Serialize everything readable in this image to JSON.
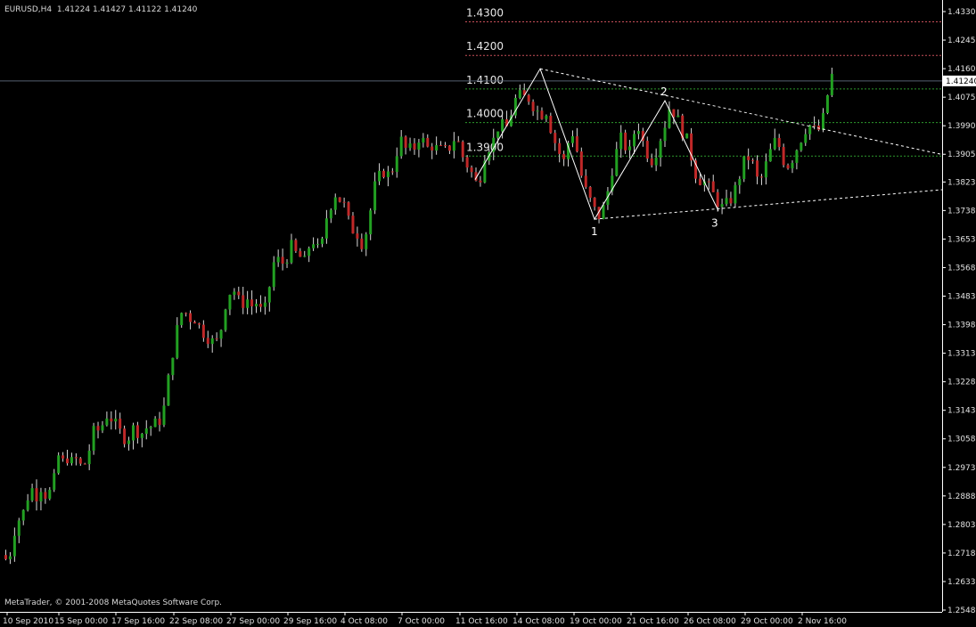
{
  "header": {
    "symbol_label": "EURUSD,H4",
    "ohlc_label": "1.41224 1.41427 1.41122 1.41240"
  },
  "footer": {
    "copyright": "MetaTrader, © 2001-2008 MetaQuotes Software Corp."
  },
  "colors": {
    "background": "#000000",
    "axis": "#ffffff",
    "bull_candle": "#22a022",
    "bear_candle": "#c02828",
    "wick": "#d8d8d8",
    "level_red": "#c8505a",
    "level_green": "#2e9a2e",
    "drawing": "#ffffff",
    "current_price_box": "#ffffff",
    "current_price_text": "#000000",
    "price_line": "#556070"
  },
  "chart_data": {
    "type": "candlestick",
    "symbol": "EURUSD",
    "timeframe": "H4",
    "ylim": [
      1.2548,
      1.4345
    ],
    "y_ticks": [
      "1.43305",
      "1.42455",
      "1.41605",
      "1.40755",
      "1.39905",
      "1.39055",
      "1.38230",
      "1.37380",
      "1.36530",
      "1.35680",
      "1.34830",
      "1.33980",
      "1.33130",
      "1.32280",
      "1.31430",
      "1.30580",
      "1.29730",
      "1.28880",
      "1.28030",
      "1.27180",
      "1.26330",
      "1.25480"
    ],
    "x_ticks": [
      "10 Sep 2010",
      "15 Sep 00:00",
      "17 Sep 16:00",
      "22 Sep 08:00",
      "27 Sep 00:00",
      "29 Sep 16:00",
      "4 Oct 08:00",
      "7 Oct 00:00",
      "11 Oct 16:00",
      "14 Oct 08:00",
      "19 Oct 00:00",
      "21 Oct 16:00",
      "26 Oct 08:00",
      "29 Oct 00:00",
      "2 Nov 16:00"
    ],
    "current_price": "1.41240",
    "close_path": [
      [
        0,
        1.27
      ],
      [
        5,
        1.272
      ],
      [
        10,
        1.279
      ],
      [
        15,
        1.282
      ],
      [
        20,
        1.284
      ],
      [
        25,
        1.289
      ],
      [
        30,
        1.291
      ],
      [
        35,
        1.289
      ],
      [
        40,
        1.292
      ],
      [
        45,
        1.289
      ],
      [
        50,
        1.29
      ],
      [
        55,
        1.294
      ],
      [
        60,
        1.302
      ],
      [
        65,
        1.298
      ],
      [
        70,
        1.301
      ],
      [
        75,
        1.298
      ],
      [
        80,
        1.3
      ],
      [
        85,
        1.297
      ],
      [
        90,
        1.299
      ],
      [
        95,
        1.304
      ],
      [
        100,
        1.309
      ],
      [
        105,
        1.308
      ],
      [
        110,
        1.311
      ],
      [
        115,
        1.314
      ],
      [
        120,
        1.311
      ],
      [
        125,
        1.309
      ],
      [
        130,
        1.307
      ],
      [
        135,
        1.306
      ],
      [
        140,
        1.307
      ],
      [
        145,
        1.31
      ],
      [
        150,
        1.307
      ],
      [
        155,
        1.308
      ],
      [
        160,
        1.31
      ],
      [
        165,
        1.309
      ],
      [
        170,
        1.311
      ],
      [
        175,
        1.312
      ],
      [
        180,
        1.318
      ],
      [
        185,
        1.329
      ],
      [
        190,
        1.335
      ],
      [
        195,
        1.342
      ],
      [
        200,
        1.345
      ],
      [
        205,
        1.341
      ],
      [
        210,
        1.343
      ],
      [
        215,
        1.34
      ],
      [
        220,
        1.338
      ],
      [
        225,
        1.337
      ],
      [
        230,
        1.335
      ],
      [
        235,
        1.334
      ],
      [
        240,
        1.336
      ],
      [
        245,
        1.345
      ],
      [
        250,
        1.349
      ],
      [
        255,
        1.351
      ],
      [
        260,
        1.347
      ],
      [
        265,
        1.346
      ],
      [
        270,
        1.348
      ],
      [
        275,
        1.345
      ],
      [
        280,
        1.347
      ],
      [
        285,
        1.344
      ],
      [
        290,
        1.343
      ],
      [
        295,
        1.35
      ],
      [
        300,
        1.358
      ],
      [
        305,
        1.359
      ],
      [
        310,
        1.358
      ],
      [
        315,
        1.36
      ],
      [
        320,
        1.363
      ],
      [
        325,
        1.361
      ],
      [
        330,
        1.36
      ],
      [
        335,
        1.358
      ],
      [
        340,
        1.363
      ],
      [
        345,
        1.365
      ],
      [
        350,
        1.362
      ],
      [
        355,
        1.364
      ],
      [
        360,
        1.372
      ],
      [
        365,
        1.376
      ],
      [
        370,
        1.379
      ],
      [
        375,
        1.377
      ],
      [
        380,
        1.375
      ],
      [
        385,
        1.37
      ],
      [
        390,
        1.368
      ],
      [
        395,
        1.367
      ],
      [
        400,
        1.364
      ],
      [
        405,
        1.368
      ],
      [
        410,
        1.375
      ],
      [
        415,
        1.382
      ],
      [
        420,
        1.384
      ],
      [
        425,
        1.386
      ],
      [
        430,
        1.384
      ],
      [
        435,
        1.387
      ],
      [
        440,
        1.393
      ],
      [
        445,
        1.395
      ],
      [
        450,
        1.391
      ],
      [
        455,
        1.392
      ],
      [
        460,
        1.393
      ],
      [
        465,
        1.397
      ],
      [
        470,
        1.393
      ],
      [
        475,
        1.392
      ],
      [
        480,
        1.394
      ],
      [
        485,
        1.391
      ],
      [
        490,
        1.392
      ],
      [
        495,
        1.391
      ],
      [
        500,
        1.394
      ],
      [
        505,
        1.396
      ],
      [
        510,
        1.392
      ],
      [
        515,
        1.388
      ],
      [
        520,
        1.387
      ],
      [
        525,
        1.383
      ],
      [
        530,
        1.381
      ],
      [
        535,
        1.388
      ],
      [
        540,
        1.394
      ],
      [
        545,
        1.392
      ],
      [
        550,
        1.398
      ],
      [
        555,
        1.4
      ],
      [
        560,
        1.397
      ],
      [
        565,
        1.401
      ],
      [
        570,
        1.406
      ],
      [
        575,
        1.408
      ],
      [
        580,
        1.407
      ],
      [
        585,
        1.408
      ],
      [
        590,
        1.406
      ],
      [
        595,
        1.404
      ],
      [
        600,
        1.402
      ],
      [
        605,
        1.405
      ],
      [
        610,
        1.4
      ],
      [
        615,
        1.395
      ],
      [
        620,
        1.392
      ],
      [
        625,
        1.387
      ],
      [
        630,
        1.393
      ],
      [
        635,
        1.398
      ],
      [
        640,
        1.393
      ],
      [
        645,
        1.385
      ],
      [
        650,
        1.38
      ],
      [
        655,
        1.377
      ],
      [
        660,
        1.374
      ],
      [
        665,
        1.372
      ],
      [
        670,
        1.374
      ],
      [
        675,
        1.379
      ],
      [
        680,
        1.386
      ],
      [
        685,
        1.391
      ],
      [
        690,
        1.395
      ],
      [
        695,
        1.393
      ],
      [
        700,
        1.391
      ],
      [
        705,
        1.397
      ],
      [
        710,
        1.399
      ],
      [
        715,
        1.394
      ],
      [
        720,
        1.391
      ],
      [
        725,
        1.389
      ],
      [
        730,
        1.392
      ],
      [
        735,
        1.396
      ],
      [
        740,
        1.4
      ],
      [
        745,
        1.405
      ],
      [
        750,
        1.403
      ],
      [
        755,
        1.4
      ],
      [
        760,
        1.397
      ],
      [
        765,
        1.394
      ],
      [
        770,
        1.389
      ],
      [
        775,
        1.384
      ],
      [
        780,
        1.383
      ],
      [
        785,
        1.382
      ],
      [
        790,
        1.38
      ],
      [
        795,
        1.378
      ],
      [
        800,
        1.376
      ],
      [
        805,
        1.374
      ],
      [
        810,
        1.376
      ],
      [
        815,
        1.378
      ],
      [
        820,
        1.381
      ],
      [
        825,
        1.386
      ],
      [
        830,
        1.389
      ],
      [
        835,
        1.39
      ],
      [
        840,
        1.386
      ],
      [
        845,
        1.381
      ],
      [
        850,
        1.385
      ],
      [
        855,
        1.389
      ],
      [
        860,
        1.393
      ],
      [
        865,
        1.395
      ],
      [
        870,
        1.391
      ],
      [
        875,
        1.387
      ],
      [
        880,
        1.388
      ],
      [
        885,
        1.391
      ],
      [
        890,
        1.394
      ],
      [
        895,
        1.397
      ],
      [
        900,
        1.4
      ],
      [
        905,
        1.398
      ],
      [
        910,
        1.397
      ],
      [
        915,
        1.399
      ],
      [
        920,
        1.404
      ],
      [
        925,
        1.415
      ],
      [
        930,
        1.412
      ],
      [
        935,
        1.4124
      ]
    ],
    "horizontal_levels": [
      {
        "label": "1.4300",
        "price": 1.43,
        "color": "red"
      },
      {
        "label": "1.4200",
        "price": 1.42,
        "color": "red"
      },
      {
        "label": "1.4100",
        "price": 1.41,
        "color": "green"
      },
      {
        "label": "1.4000",
        "price": 1.4,
        "color": "green"
      },
      {
        "label": "1.3900",
        "price": 1.39,
        "color": "green"
      }
    ],
    "annotations": [
      {
        "label": "1",
        "price": 1.3712
      },
      {
        "label": "2",
        "price": 1.4065
      },
      {
        "label": "3",
        "price": 1.3737
      }
    ]
  }
}
